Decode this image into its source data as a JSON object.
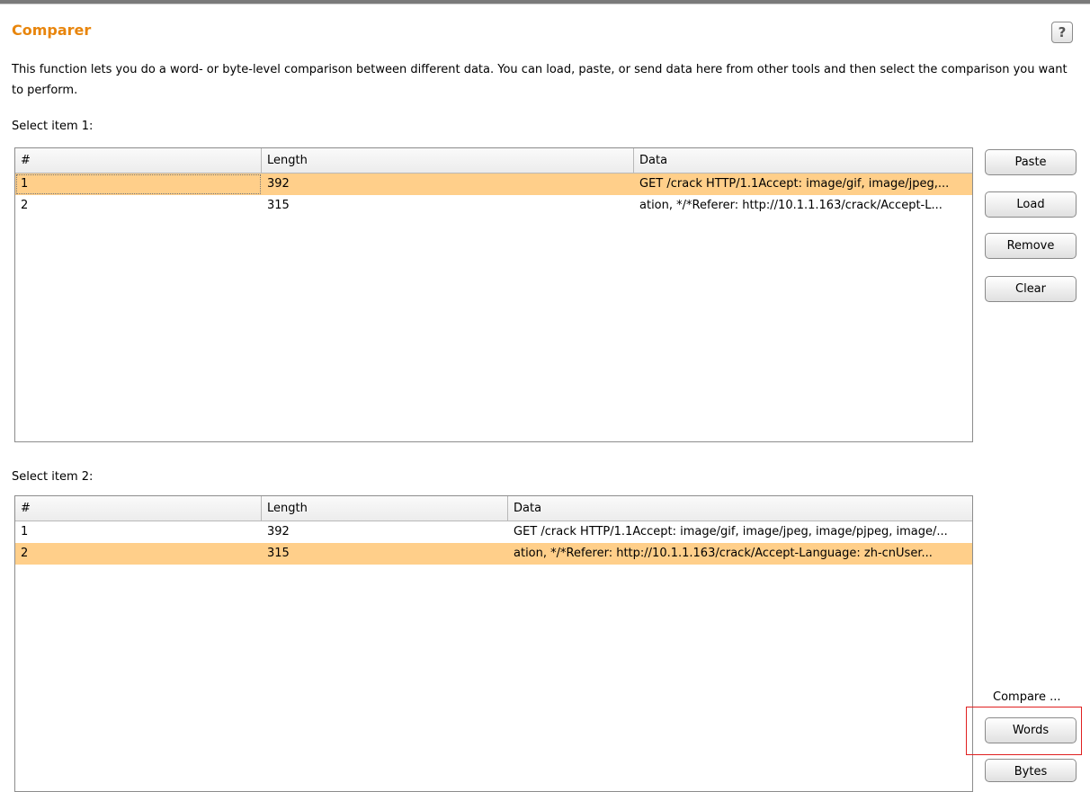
{
  "header": {
    "title": "Comparer",
    "help_glyph": "?",
    "description": "This function lets you do a word- or byte-level comparison between different data. You can load, paste, or send data here from other tools and then select the comparison you want to perform."
  },
  "item1": {
    "label": "Select item 1:",
    "columns": [
      "#",
      "Length",
      "Data"
    ],
    "rows": [
      {
        "num": "1",
        "length": "392",
        "data": "GET /crack HTTP/1.1Accept: image/gif, image/jpeg,...",
        "selected": true
      },
      {
        "num": "2",
        "length": "315",
        "data": "ation, */*Referer: http://10.1.1.163/crack/Accept-L...",
        "selected": false
      }
    ]
  },
  "item2": {
    "label": "Select item 2:",
    "columns": [
      "#",
      "Length",
      "Data"
    ],
    "rows": [
      {
        "num": "1",
        "length": "392",
        "data": "GET /crack HTTP/1.1Accept: image/gif, image/jpeg, image/pjpeg, image/...",
        "selected": false
      },
      {
        "num": "2",
        "length": "315",
        "data": "ation, */*Referer: http://10.1.1.163/crack/Accept-Language: zh-cnUser...",
        "selected": true
      }
    ]
  },
  "buttons": {
    "paste": "Paste",
    "load": "Load",
    "remove": "Remove",
    "clear": "Clear"
  },
  "compare": {
    "label": "Compare ...",
    "words": "Words",
    "bytes": "Bytes"
  },
  "colors": {
    "title": "#e8850c",
    "selected_row": "#ffcf8a",
    "highlight_box": "#e02020"
  }
}
